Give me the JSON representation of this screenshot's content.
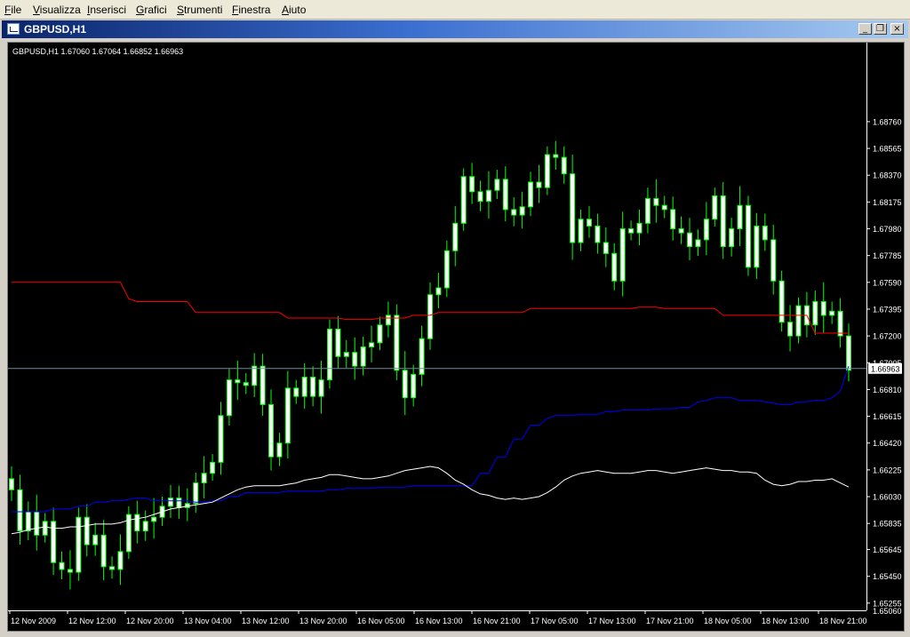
{
  "menu": {
    "items": [
      {
        "label": "File",
        "accel": "F"
      },
      {
        "label": "Visualizza",
        "accel": "V"
      },
      {
        "label": "Inserisci",
        "accel": "I"
      },
      {
        "label": "Grafici",
        "accel": "G"
      },
      {
        "label": "Strumenti",
        "accel": "S"
      },
      {
        "label": "Finestra",
        "accel": "F"
      },
      {
        "label": "Aiuto",
        "accel": "A"
      }
    ]
  },
  "window": {
    "title": "GBPUSD,H1",
    "buttons": {
      "minimize": "_",
      "restore": "❐",
      "close": "×"
    }
  },
  "chart": {
    "info_label": "GBPUSD,H1  1.67060 1.67064 1.66852 1.66963",
    "current_price": "1.66963",
    "colors": {
      "background": "#000000",
      "bull_candle": "#00ff00",
      "candle_body": "#ffffff",
      "upper_line": "#ff0000",
      "lower_line": "#0000ff",
      "middle_line": "#ffffff",
      "price_line": "#778899"
    }
  },
  "chart_data": {
    "type": "candlestick",
    "y_ticks": [
      "1.68760",
      "1.68565",
      "1.68370",
      "1.68175",
      "1.67980",
      "1.67785",
      "1.67590",
      "1.67395",
      "1.67200",
      "1.67005",
      "1.66810",
      "1.66615",
      "1.66420",
      "1.66225",
      "1.66030",
      "1.65835",
      "1.65645",
      "1.65450",
      "1.65255",
      "1.65060"
    ],
    "ylim": [
      1.6506,
      1.6896
    ],
    "x_ticks": [
      "12 Nov 2009",
      "12 Nov 12:00",
      "12 Nov 20:00",
      "13 Nov 04:00",
      "13 Nov 12:00",
      "13 Nov 20:00",
      "16 Nov 05:00",
      "16 Nov 13:00",
      "16 Nov 21:00",
      "17 Nov 05:00",
      "17 Nov 13:00",
      "17 Nov 21:00",
      "18 Nov 05:00",
      "18 Nov 13:00",
      "18 Nov 21:00"
    ],
    "closes": [
      1.6608,
      1.6578,
      1.6592,
      1.6575,
      1.6585,
      1.6555,
      1.655,
      1.6548,
      1.6588,
      1.6568,
      1.6575,
      1.6552,
      1.655,
      1.6563,
      1.659,
      1.6578,
      1.6585,
      1.6588,
      1.6596,
      1.6602,
      1.6595,
      1.6598,
      1.6613,
      1.662,
      1.6628,
      1.6662,
      1.6688,
      1.6686,
      1.6684,
      1.6698,
      1.667,
      1.6632,
      1.6642,
      1.6682,
      1.6676,
      1.669,
      1.6676,
      1.6688,
      1.6725,
      1.6705,
      1.6708,
      1.6698,
      1.6712,
      1.6715,
      1.6728,
      1.6735,
      1.6695,
      1.6675,
      1.6692,
      1.6718,
      1.675,
      1.6755,
      1.6782,
      1.6802,
      1.6836,
      1.6825,
      1.6818,
      1.6826,
      1.6834,
      1.6812,
      1.6808,
      1.6814,
      1.6832,
      1.6828,
      1.6852,
      1.685,
      1.6838,
      1.6788,
      1.6805,
      1.68,
      1.6788,
      1.678,
      1.676,
      1.6798,
      1.6795,
      1.6802,
      1.682,
      1.6815,
      1.6812,
      1.6798,
      1.6795,
      1.6785,
      1.679,
      1.6805,
      1.6822,
      1.6785,
      1.6798,
      1.6815,
      1.677,
      1.68,
      1.679,
      1.676,
      1.673,
      1.672,
      1.6742,
      1.6728,
      1.6745,
      1.6735,
      1.6738,
      1.672,
      1.6695
    ],
    "upper_line": [
      1.6759,
      1.6759,
      1.6759,
      1.6759,
      1.6759,
      1.6759,
      1.6759,
      1.6759,
      1.6759,
      1.6759,
      1.6759,
      1.6759,
      1.6759,
      1.6759,
      1.6747,
      1.6745,
      1.6745,
      1.6745,
      1.6745,
      1.6745,
      1.6745,
      1.6745,
      1.6737,
      1.6737,
      1.6737,
      1.6737,
      1.6737,
      1.6737,
      1.6737,
      1.6737,
      1.6737,
      1.6737,
      1.6737,
      1.6733,
      1.6733,
      1.6733,
      1.6733,
      1.6733,
      1.6733,
      1.6733,
      1.6732,
      1.6732,
      1.6732,
      1.6732,
      1.6733,
      1.6733,
      1.6733,
      1.6733,
      1.6735,
      1.6735,
      1.6735,
      1.6737,
      1.6737,
      1.6737,
      1.6737,
      1.6737,
      1.6737,
      1.6737,
      1.6737,
      1.6737,
      1.6737,
      1.6737,
      1.674,
      1.674,
      1.674,
      1.674,
      1.674,
      1.674,
      1.674,
      1.674,
      1.674,
      1.674,
      1.674,
      1.674,
      1.674,
      1.6741,
      1.6741,
      1.6741,
      1.674,
      1.674,
      1.674,
      1.674,
      1.674,
      1.674,
      1.674,
      1.6735,
      1.6735,
      1.6735,
      1.6735,
      1.6735,
      1.6735,
      1.6735,
      1.6735,
      1.6735,
      1.6735,
      1.6735,
      1.6722,
      1.6722,
      1.6722,
      1.6722,
      1.6722
    ],
    "lower_line": [
      1.6592,
      1.6592,
      1.6592,
      1.6592,
      1.6592,
      1.6594,
      1.6594,
      1.6594,
      1.6596,
      1.6596,
      1.6599,
      1.6599,
      1.66,
      1.66,
      1.6601,
      1.6602,
      1.6602,
      1.66,
      1.66,
      1.66,
      1.66,
      1.66,
      1.6599,
      1.6599,
      1.66,
      1.66,
      1.6603,
      1.6603,
      1.6606,
      1.6606,
      1.6606,
      1.6606,
      1.6606,
      1.6607,
      1.6607,
      1.6607,
      1.6607,
      1.6607,
      1.6608,
      1.6608,
      1.6609,
      1.6609,
      1.6609,
      1.6609,
      1.661,
      1.661,
      1.661,
      1.661,
      1.6611,
      1.6611,
      1.6611,
      1.6611,
      1.6611,
      1.6611,
      1.6611,
      1.6611,
      1.662,
      1.662,
      1.6632,
      1.6632,
      1.6645,
      1.6645,
      1.6655,
      1.6655,
      1.666,
      1.6662,
      1.6662,
      1.6662,
      1.6663,
      1.6663,
      1.6663,
      1.6665,
      1.6665,
      1.6666,
      1.6666,
      1.6666,
      1.6666,
      1.6667,
      1.6667,
      1.6667,
      1.6668,
      1.6668,
      1.6672,
      1.6673,
      1.6675,
      1.6675,
      1.6675,
      1.6673,
      1.6673,
      1.6673,
      1.6672,
      1.6671,
      1.667,
      1.667,
      1.6672,
      1.6672,
      1.6673,
      1.6673,
      1.6675,
      1.668,
      1.6698
    ],
    "middle_line": [
      1.6576,
      1.6577,
      1.6579,
      1.658,
      1.6581,
      1.658,
      1.658,
      1.6581,
      1.6581,
      1.6582,
      1.6583,
      1.6583,
      1.6583,
      1.6584,
      1.6586,
      1.6587,
      1.6588,
      1.659,
      1.6592,
      1.6594,
      1.6595,
      1.6596,
      1.6597,
      1.6598,
      1.6599,
      1.6602,
      1.6605,
      1.6608,
      1.661,
      1.6611,
      1.6611,
      1.6611,
      1.6611,
      1.6612,
      1.6613,
      1.6615,
      1.6616,
      1.6617,
      1.6619,
      1.6619,
      1.6618,
      1.6617,
      1.6616,
      1.6616,
      1.6617,
      1.6618,
      1.662,
      1.6622,
      1.6623,
      1.6624,
      1.6625,
      1.6624,
      1.662,
      1.6615,
      1.6612,
      1.6608,
      1.6605,
      1.6604,
      1.6602,
      1.6601,
      1.6602,
      1.6601,
      1.6602,
      1.6603,
      1.6606,
      1.661,
      1.6615,
      1.6618,
      1.662,
      1.6621,
      1.6622,
      1.6621,
      1.662,
      1.662,
      1.662,
      1.6621,
      1.6622,
      1.6622,
      1.6621,
      1.662,
      1.6621,
      1.6622,
      1.6623,
      1.6624,
      1.6623,
      1.6622,
      1.6622,
      1.6621,
      1.6621,
      1.662,
      1.6615,
      1.6612,
      1.6611,
      1.6612,
      1.6614,
      1.6614,
      1.6615,
      1.6615,
      1.6616,
      1.6613,
      1.661
    ]
  }
}
